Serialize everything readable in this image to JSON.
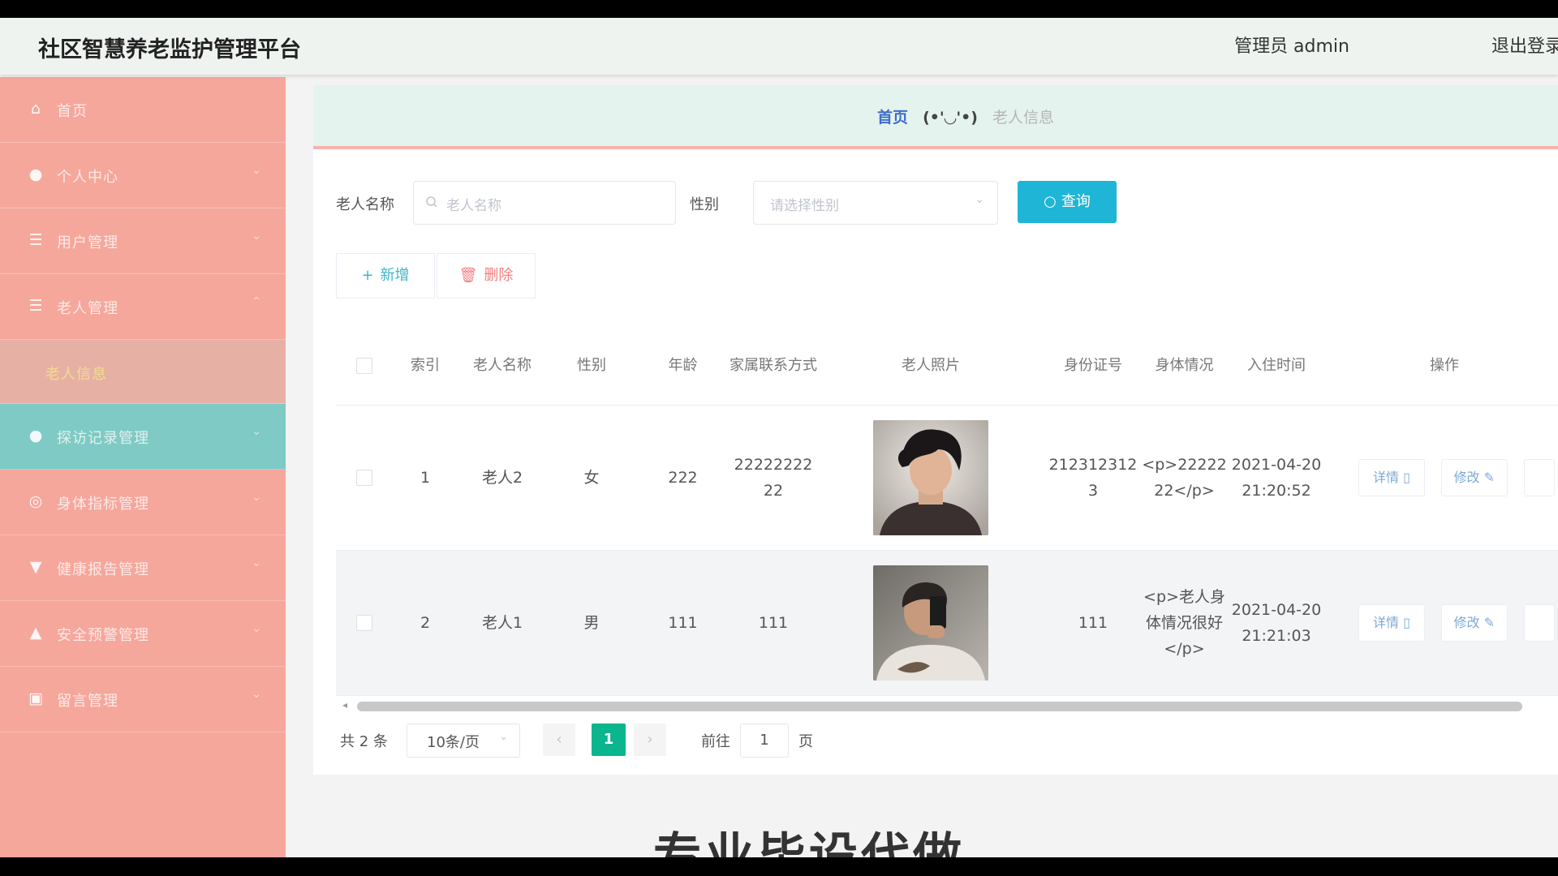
{
  "header": {
    "title": "社区智慧养老监护管理平台",
    "admin_label": "管理员 admin",
    "logout": "退出登录"
  },
  "sidebar": {
    "items": [
      {
        "label": "首页",
        "icon": "home-icon"
      },
      {
        "label": "个人中心",
        "icon": "user-icon"
      },
      {
        "label": "用户管理",
        "icon": "list-icon"
      },
      {
        "label": "老人管理",
        "icon": "list-icon"
      },
      {
        "label": "老人信息",
        "icon": ""
      },
      {
        "label": "探访记录管理",
        "icon": "person-icon"
      },
      {
        "label": "身体指标管理",
        "icon": "gauge-icon"
      },
      {
        "label": "健康报告管理",
        "icon": "trophy-icon"
      },
      {
        "label": "安全预警管理",
        "icon": "alarm-icon"
      },
      {
        "label": "留言管理",
        "icon": "message-icon"
      }
    ]
  },
  "breadcrumb": {
    "home": "首页",
    "separator": "(•'◡'•)",
    "current": "老人信息"
  },
  "search": {
    "name_label": "老人名称",
    "name_placeholder": "老人名称",
    "gender_label": "性别",
    "gender_placeholder": "请选择性别",
    "query_button": "查询"
  },
  "actions": {
    "add": "新增",
    "delete": "删除"
  },
  "table": {
    "columns": [
      "索引",
      "老人名称",
      "性别",
      "年龄",
      "家属联系方式",
      "老人照片",
      "身份证号",
      "身体情况",
      "入住时间",
      "操作"
    ],
    "rows": [
      {
        "index": "1",
        "name": "老人2",
        "gender": "女",
        "age": "222",
        "contact": "2222222222",
        "id_no": "2123123123",
        "health": "<p>2222222</p>",
        "checkin": "2021-04-20 21:20:52",
        "detail": "详情",
        "edit": "修改"
      },
      {
        "index": "2",
        "name": "老人1",
        "gender": "男",
        "age": "111",
        "contact": "111",
        "id_no": "111",
        "health": "<p>老人身体情况很好</p>",
        "checkin": "2021-04-20 21:21:03",
        "detail": "详情",
        "edit": "修改"
      }
    ]
  },
  "pagination": {
    "total": "共 2 条",
    "page_size": "10条/页",
    "current_page": "1",
    "goto_prefix": "前往",
    "goto_value": "1",
    "goto_suffix": "页"
  },
  "watermark": "专业毕设代做",
  "colors": {
    "sidebar": "#f6a79c",
    "active": "#7fcac5",
    "query": "#1fb5d6",
    "page_active": "#0bb58d"
  }
}
